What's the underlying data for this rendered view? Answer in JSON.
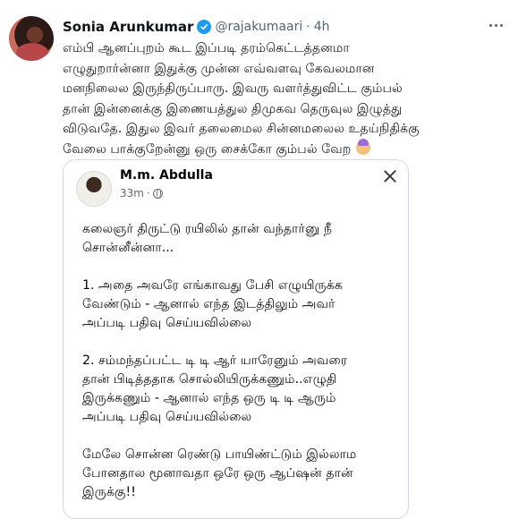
{
  "tweet": {
    "display_name": "Sonia Arunkumar",
    "handle": "@rajakumaari",
    "separator": "·",
    "time": "4h",
    "text_lines": [
      "எம்பி ஆனப்புறம் கூட இப்படி தரம்கெட்டத்தனமா",
      "எழுதுறார்ன்னா இதுக்கு முன்ன எவ்வளவு கேவலமான",
      "மனநிலைல இருந்திருப்பாரு. இவரு வளர்த்துவிட்ட கும்பல்",
      "தான் இன்னைக்கு இணையத்துல திமுகவ தெருவுல இழுத்து",
      "விடுவதே. இதுல இவர் தலைமைல சின்னமலைல உதய்நிதிக்கு",
      "வேலை பாக்குறேன்னு ஒரு சைக்கோ கும்பல் வேற"
    ]
  },
  "embedded_post": {
    "author": "M.m. Abdulla",
    "time": "33m",
    "paragraphs": [
      [
        "கலைஞர் திருட்டு ரயிலில் தான் வந்தார்னு நீ",
        "சொன்னீன்னா..."
      ],
      [
        "1. அதை அவரே எங்காவது பேசி எழுயிருக்க",
        "வேண்டும் - ஆனால் எந்த இடத்திலும் அவர்",
        "அப்படி பதிவு செய்யவில்லை"
      ],
      [
        "2. சம்மந்தப்பட்ட டி டி ஆர் யாரேனும் அவரை",
        "தான் பிடித்ததாக சொல்லியிருக்கணும்..எழுதி",
        "இருக்கணும் - ஆனால் எந்த ஒரு டி டி ஆரும்",
        "அப்படி பதிவு செய்யவில்லை"
      ],
      [
        "மேலே சொன்ன ரெண்டு பாயிண்ட்டும் இல்லாம",
        "போனதால மூனாவதா ஒரே ஒரு ஆப்ஷன் தான்",
        "இருக்கு!!"
      ]
    ]
  },
  "colors": {
    "verified": "#1d9bf0",
    "muted_text": "#536471",
    "border": "#cfd9de"
  },
  "icons": {
    "verified": "verified-badge-icon",
    "more": "more-options-icon",
    "close": "close-icon",
    "globe": "globe-icon",
    "emoji": "facepalm-emoji"
  }
}
